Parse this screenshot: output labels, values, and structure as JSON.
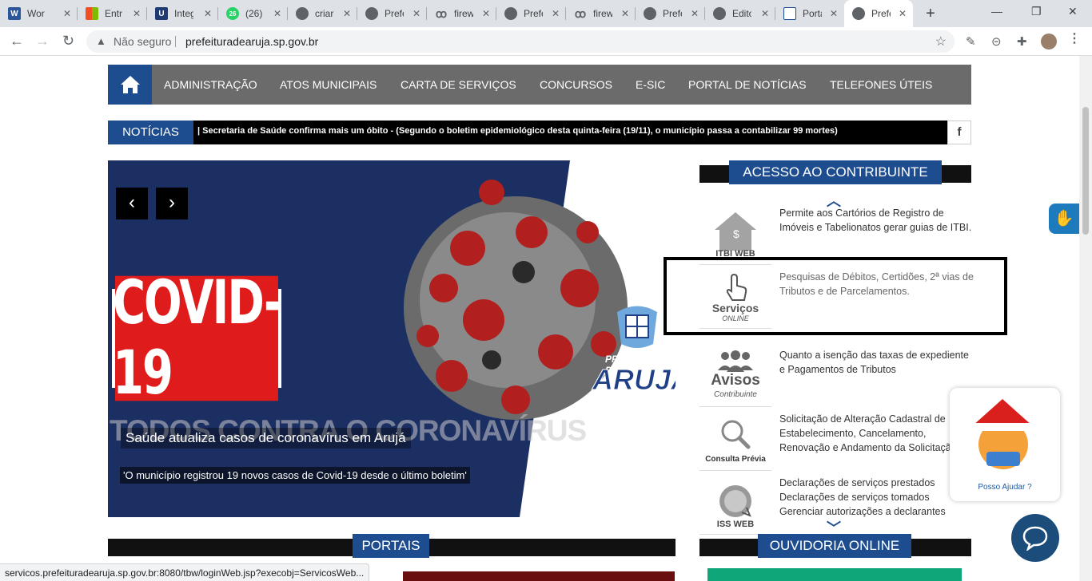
{
  "browser": {
    "tabs": [
      {
        "title": "Wor",
        "favicon": "W",
        "favcolor": "#2b579a"
      },
      {
        "title": "Entr",
        "favicon": "ms",
        "favcolor": "#f25022"
      },
      {
        "title": "Integ",
        "favicon": "U",
        "favcolor": "#1f3b73"
      },
      {
        "title": "(26)",
        "favicon": "26",
        "favcolor": "#25d366"
      },
      {
        "title": "criar",
        "favicon": "globe",
        "favcolor": "#5f6368"
      },
      {
        "title": "Prefe",
        "favicon": "globe",
        "favcolor": "#5f6368"
      },
      {
        "title": "firew",
        "favicon": "bug",
        "favcolor": "#5f6368"
      },
      {
        "title": "Prefe",
        "favicon": "globe",
        "favcolor": "#5f6368"
      },
      {
        "title": "firew",
        "favicon": "bug",
        "favcolor": "#5f6368"
      },
      {
        "title": "Prefe",
        "favicon": "globe",
        "favcolor": "#5f6368"
      },
      {
        "title": "Edito",
        "favicon": "globe",
        "favcolor": "#5f6368"
      },
      {
        "title": "Porta",
        "favicon": "crest",
        "favcolor": "#1e4d8f"
      },
      {
        "title": "Prefe",
        "favicon": "globe",
        "favcolor": "#5f6368",
        "active": true
      }
    ],
    "security_label": "Não seguro",
    "url": "prefeituradearuja.sp.gov.br",
    "status_url": "servicos.prefeituradearuja.sp.gov.br:8080/tbw/loginWeb.jsp?execobj=ServicosWeb..."
  },
  "nav": {
    "items": [
      "ADMINISTRAÇÃO",
      "ATOS MUNICIPAIS",
      "CARTA DE SERVIÇOS",
      "CONCURSOS",
      "E-SIC",
      "PORTAL DE NOTÍCIAS",
      "TELEFONES ÚTEIS"
    ]
  },
  "news": {
    "label": "NOTÍCIAS",
    "ticker": "| Secretaria de Saúde confirma mais um óbito - (Segundo o boletim epidemiológico desta quinta-feira (19/11), o município passa a contabilizar 99 mortes)",
    "fb": "f"
  },
  "slider": {
    "covid": "COVID-19",
    "banner": "TODOS CONTRA O CORONAVÍRUS",
    "caption": "Saúde atualiza casos de coronavírus em Arujá",
    "subcaption": "'O município registrou 19 novos casos de Covid-19 desde o último boletim'",
    "logo_line1": "PREFEITURA DE",
    "logo_line2": "ARUJÁ",
    "prev": "‹",
    "next": "›"
  },
  "acesso": {
    "title": "ACESSO AO CONTRIBUINTE",
    "services": [
      {
        "icon": "itbi-web",
        "caption": "ITBI WEB",
        "desc": "Permite aos Cartórios de Registro de Imóveis e Tabelionatos gerar guias de ITBI."
      },
      {
        "icon": "servicos-online",
        "caption": "Serviços",
        "caption2": "ONLINE",
        "desc": "Pesquisas de Débitos, Certidões, 2ª vias de Tributos e de Parcelamentos."
      },
      {
        "icon": "avisos",
        "caption": "Avisos",
        "caption2": "Contribuinte",
        "desc": "Quanto a isenção das taxas de expediente e Pagamentos de Tributos"
      },
      {
        "icon": "consulta-previa",
        "caption": "Consulta Prévia",
        "desc": "Solicitação de Alteração Cadastral de Estabelecimento, Cancelamento, Renovação e Andamento da Solicitação"
      },
      {
        "icon": "iss-web",
        "caption": "ISS WEB",
        "desc": "Declarações de serviços prestados Declarações de serviços tomados Gerenciar autorizações a declarantes"
      }
    ]
  },
  "portais": {
    "title": "PORTAIS"
  },
  "ouvidoria": {
    "title": "OUVIDORIA ONLINE"
  },
  "assist": {
    "label": "Posso Ajudar ?"
  },
  "colors": {
    "primary": "#1e4d8f",
    "navbar": "#6b6b6b",
    "dark": "#111111"
  }
}
